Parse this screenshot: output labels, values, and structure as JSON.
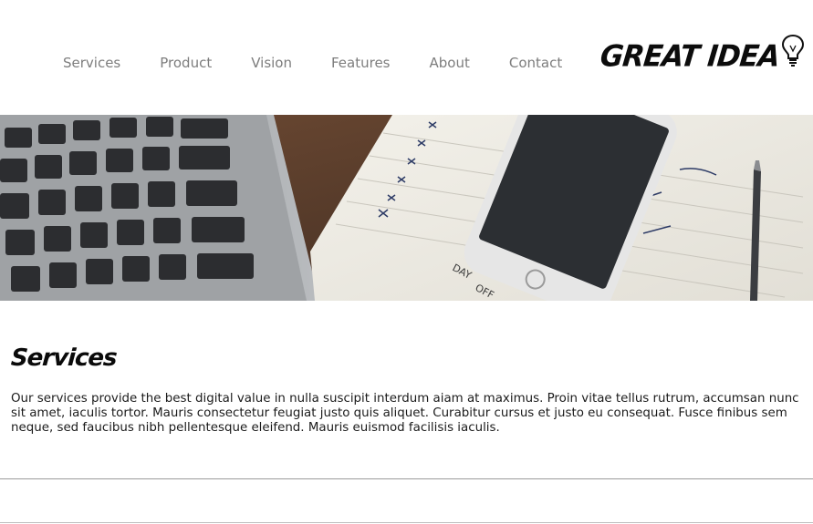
{
  "nav": {
    "items": [
      {
        "label": "Services"
      },
      {
        "label": "Product"
      },
      {
        "label": "Vision"
      },
      {
        "label": "Features"
      },
      {
        "label": "About"
      },
      {
        "label": "Contact"
      }
    ]
  },
  "logo": {
    "text": "GREAT IDEA",
    "icon": "lightbulb-icon"
  },
  "hero": {
    "image": "laptop-keyboard-phone-notebook-photo",
    "notebook_text": [
      "DAY",
      "OFF"
    ]
  },
  "section": {
    "title": "Services",
    "body": "Our services provide the best digital value in nulla suscipit interdum aiam at maximus. Proin vitae tellus rutrum, accumsan nunc sit amet, iaculis tortor. Mauris consectetur feugiat justo quis aliquet. Curabitur cursus et justo eu consequat. Fusce finibus sem neque, sed faucibus nibh pellentesque eleifend. Mauris euismod facilisis iaculis."
  },
  "colors": {
    "nav_text": "#7d7d7d",
    "text": "#1b1b1b",
    "divider": "#9a9a9a"
  }
}
